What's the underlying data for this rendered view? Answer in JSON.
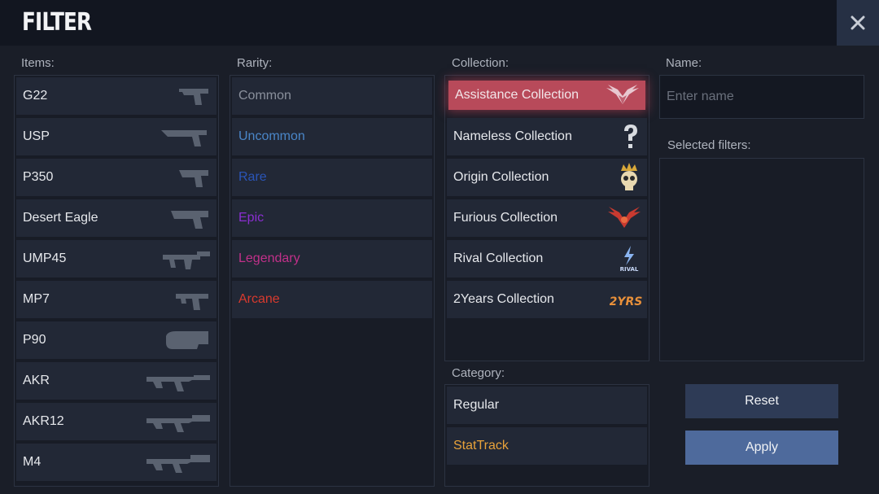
{
  "title": "FILTER",
  "labels": {
    "items": "Items:",
    "rarity": "Rarity:",
    "collection": "Collection:",
    "name": "Name:",
    "category": "Category:",
    "selected_filters": "Selected filters:"
  },
  "name_input": {
    "placeholder": "Enter name",
    "value": ""
  },
  "items": [
    "G22",
    "USP",
    "P350",
    "Desert Eagle",
    "UMP45",
    "MP7",
    "P90",
    "AKR",
    "AKR12",
    "M4"
  ],
  "rarity": [
    {
      "label": "Common",
      "color": "#8a909c"
    },
    {
      "label": "Uncommon",
      "color": "#4a86c8"
    },
    {
      "label": "Rare",
      "color": "#2a55b8"
    },
    {
      "label": "Epic",
      "color": "#8a2ed0"
    },
    {
      "label": "Legendary",
      "color": "#c2308a"
    },
    {
      "label": "Arcane",
      "color": "#d83a2e"
    }
  ],
  "collections": [
    {
      "label": "Assistance Collection",
      "icon": "wings-emblem-icon",
      "selected": true
    },
    {
      "label": "Nameless Collection",
      "icon": "question-mark-icon"
    },
    {
      "label": "Origin Collection",
      "icon": "skull-crown-icon"
    },
    {
      "label": "Furious Collection",
      "icon": "red-wings-icon"
    },
    {
      "label": "Rival Collection",
      "icon": "rival-logo-icon",
      "logo_text": "RIVAL"
    },
    {
      "label": "2Years Collection",
      "icon": "two-years-logo-icon",
      "logo_text": "2YRS"
    }
  ],
  "categories": [
    {
      "label": "Regular",
      "color": "#e6e8ec"
    },
    {
      "label": "StatTrack",
      "color": "#e8a23a"
    }
  ],
  "buttons": {
    "reset": "Reset",
    "apply": "Apply"
  },
  "colors": {
    "selected_collection": "#b84a5a",
    "apply": "#4e6a9c",
    "reset": "#2e3b56"
  }
}
